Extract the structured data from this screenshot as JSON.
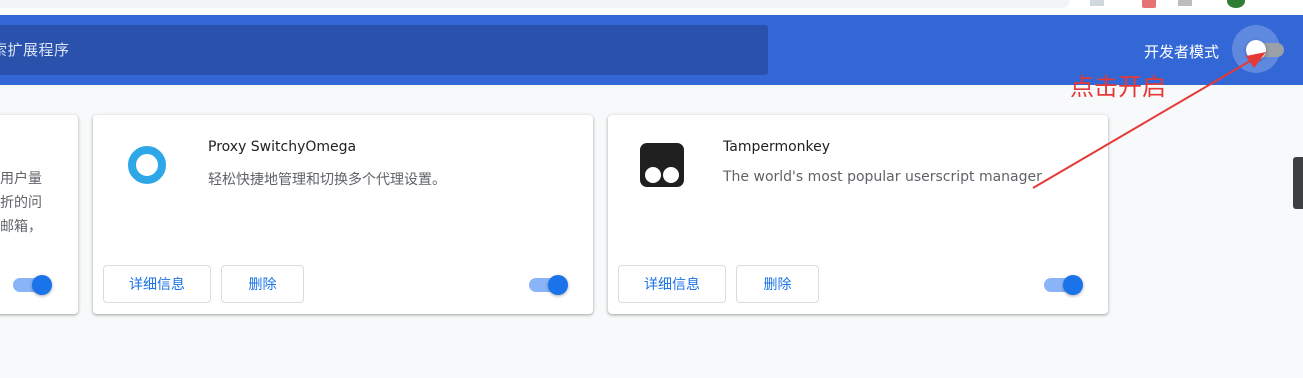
{
  "search": {
    "text": "索扩展程序"
  },
  "header": {
    "dev_mode_label": "开发者模式",
    "dev_mode_on": false
  },
  "annotation": {
    "text": "点击开启",
    "color": "#e53935"
  },
  "colors": {
    "header": "#3367d6",
    "accent": "#1a73e8"
  },
  "extensions": [
    {
      "partial": true,
      "desc_lines": [
        "用户量",
        "折的问",
        "邮箱，"
      ],
      "enabled": true
    },
    {
      "name": "Proxy SwitchyOmega",
      "description": "轻松快捷地管理和切换多个代理设置。",
      "icon": "switchyomega-ring-icon",
      "details_label": "详细信息",
      "remove_label": "删除",
      "enabled": true
    },
    {
      "name": "Tampermonkey",
      "description": "The world's most popular userscript manager",
      "icon": "tampermonkey-icon",
      "details_label": "详细信息",
      "remove_label": "删除",
      "enabled": true
    }
  ]
}
